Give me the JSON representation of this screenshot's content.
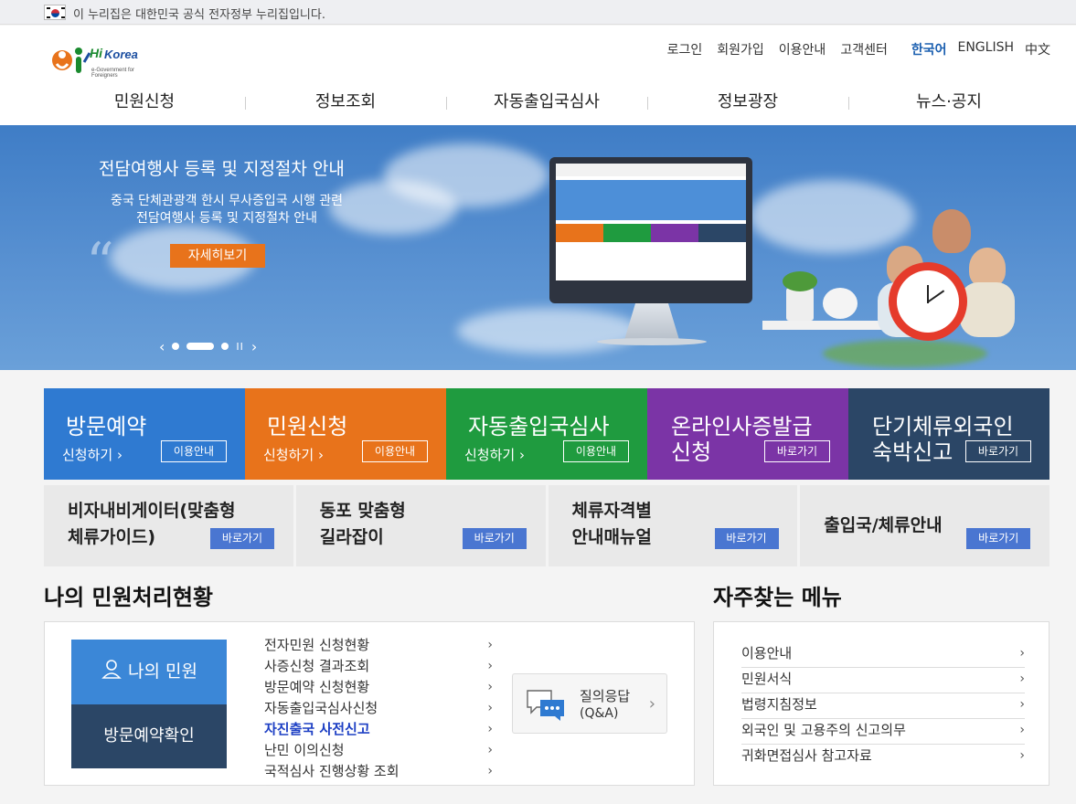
{
  "govbar": {
    "text": "이 누리집은 대한민국 공식 전자정부 누리집입니다."
  },
  "logo": {
    "hi": "Hi",
    "korea": "Korea",
    "sub": "e-Government for Foreigners"
  },
  "util": {
    "links": [
      "로그인",
      "회원가입",
      "이용안내",
      "고객센터"
    ],
    "langs": [
      "한국어",
      "ENGLISH",
      "中文"
    ],
    "active_lang": "한국어"
  },
  "gnb": [
    "민원신청",
    "정보조회",
    "자동출입국심사",
    "정보광장",
    "뉴스·공지"
  ],
  "hero": {
    "title": "전담여행사 등록 및 지정절차 안내",
    "desc_line1": "중국 단체관광객 한시 무사증입국 시행 관련",
    "desc_line2": "전담여행사 등록 및 지정절차 안내",
    "more": "자세히보기",
    "quote": "“",
    "prev": "‹",
    "next": "›",
    "pause": "II",
    "slide_count": 3,
    "active_slide": 2
  },
  "tiles": [
    {
      "title": "방문예약",
      "sub": "신청하기 ›",
      "btn": "이용안내",
      "color": "#2f7ad1"
    },
    {
      "title": "민원신청",
      "sub": "신청하기 ›",
      "btn": "이용안내",
      "color": "#e8731b"
    },
    {
      "title": "자동출입국심사",
      "sub": "신청하기 ›",
      "btn": "이용안내",
      "color": "#1f9b3f"
    },
    {
      "title_l1": "온라인사증발급",
      "title_l2": "신청",
      "btn": "바로가기",
      "color": "#7b34a6"
    },
    {
      "title_l1": "단기체류외국인",
      "title_l2": "숙박신고",
      "btn": "바로가기",
      "color": "#2b4666"
    }
  ],
  "guides": [
    {
      "l1": "비자내비게이터(맞춤형",
      "l2": "체류가이드)",
      "btn": "바로가기"
    },
    {
      "l1": "동포 맞춤형",
      "l2": "길라잡이",
      "btn": "바로가기"
    },
    {
      "l1": "체류자격별",
      "l2": "안내매뉴얼",
      "btn": "바로가기"
    },
    {
      "l1": "출입국/체류안내",
      "btn": "바로가기"
    }
  ],
  "my": {
    "title": "나의 민원처리현황",
    "btn_my": "나의 민원",
    "btn_visit": "방문예약확인",
    "items": [
      "전자민원 신청현황",
      "사증신청 결과조회",
      "방문예약 신청현황",
      "자동출입국심사신청",
      "자진출국 사전신고",
      "난민 이의신청",
      "국적심사 진행상황 조회"
    ],
    "highlight_index": 4,
    "qna_l1": "질의응답",
    "qna_l2": "(Q&A)"
  },
  "fav": {
    "title": "자주찾는 메뉴",
    "items": [
      "이용안내",
      "민원서식",
      "법령지침정보",
      "외국인 및 고용주의 신고의무",
      "귀화면접심사 참고자료"
    ]
  },
  "chevron": "›"
}
